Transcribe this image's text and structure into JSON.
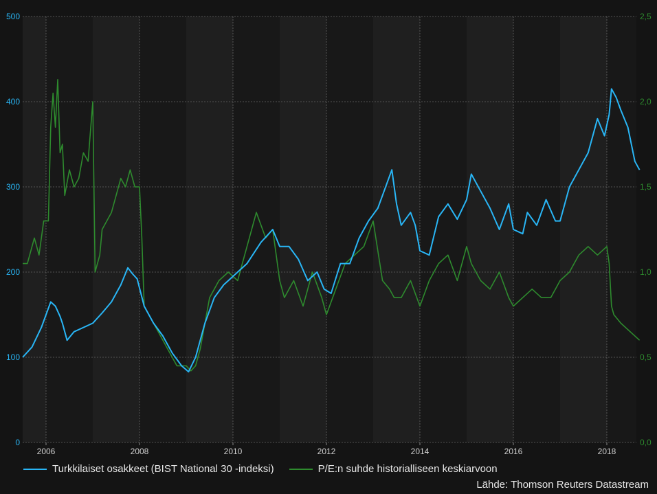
{
  "chart_data": {
    "type": "line",
    "x_ticks": [
      "2006",
      "2008",
      "2010",
      "2012",
      "2014",
      "2016",
      "2018"
    ],
    "y_left": {
      "ticks": [
        "0",
        "100",
        "200",
        "300",
        "400",
        "500"
      ],
      "range": [
        0,
        500
      ],
      "color": "#29b6f6"
    },
    "y_right": {
      "ticks": [
        "0,0",
        "0,5",
        "1,0",
        "1,5",
        "2,0",
        "2,5"
      ],
      "range": [
        0,
        2.5
      ],
      "color": "#2e8b2e"
    },
    "grid": true,
    "legend_position": "bottom-left",
    "series": [
      {
        "name": "Turkkilaiset osakkeet (BIST National 30 -indeksi)",
        "axis": "left",
        "color": "#29b6f6",
        "x": [
          2005.5,
          2005.7,
          2005.9,
          2006.1,
          2006.2,
          2006.3,
          2006.35,
          2006.45,
          2006.6,
          2006.8,
          2007.0,
          2007.2,
          2007.4,
          2007.6,
          2007.75,
          2007.85,
          2007.95,
          2008.1,
          2008.3,
          2008.5,
          2008.7,
          2008.9,
          2009.05,
          2009.2,
          2009.4,
          2009.6,
          2009.8,
          2010.0,
          2010.3,
          2010.6,
          2010.85,
          2011.0,
          2011.2,
          2011.4,
          2011.6,
          2011.8,
          2011.95,
          2012.1,
          2012.3,
          2012.5,
          2012.7,
          2012.9,
          2013.1,
          2013.3,
          2013.4,
          2013.5,
          2013.6,
          2013.8,
          2013.9,
          2014.0,
          2014.2,
          2014.4,
          2014.6,
          2014.8,
          2015.0,
          2015.1,
          2015.3,
          2015.5,
          2015.7,
          2015.9,
          2016.0,
          2016.2,
          2016.3,
          2016.5,
          2016.7,
          2016.9,
          2017.0,
          2017.2,
          2017.4,
          2017.6,
          2017.8,
          2017.95,
          2018.05,
          2018.1,
          2018.2,
          2018.3,
          2018.45,
          2018.6,
          2018.7
        ],
        "values": [
          100,
          112,
          135,
          165,
          160,
          148,
          140,
          120,
          130,
          135,
          140,
          152,
          165,
          185,
          205,
          198,
          192,
          160,
          140,
          125,
          105,
          90,
          83,
          100,
          140,
          170,
          185,
          195,
          210,
          235,
          250,
          230,
          230,
          215,
          190,
          200,
          180,
          175,
          210,
          210,
          240,
          260,
          275,
          305,
          320,
          280,
          255,
          270,
          255,
          225,
          220,
          265,
          280,
          262,
          285,
          315,
          295,
          275,
          250,
          280,
          250,
          245,
          270,
          255,
          285,
          260,
          260,
          300,
          320,
          340,
          380,
          360,
          385,
          415,
          405,
          390,
          370,
          330,
          320
        ]
      },
      {
        "name": "P/E:n suhde historialliseen keskiarvoon",
        "axis": "right",
        "color": "#2e8b2e",
        "x": [
          2005.5,
          2005.6,
          2005.75,
          2005.85,
          2005.95,
          2006.05,
          2006.1,
          2006.15,
          2006.2,
          2006.25,
          2006.3,
          2006.35,
          2006.4,
          2006.5,
          2006.6,
          2006.7,
          2006.8,
          2006.9,
          2007.0,
          2007.05,
          2007.1,
          2007.15,
          2007.2,
          2007.4,
          2007.5,
          2007.6,
          2007.7,
          2007.8,
          2007.9,
          2008.0,
          2008.05,
          2008.1,
          2008.2,
          2008.4,
          2008.6,
          2008.8,
          2009.0,
          2009.1,
          2009.2,
          2009.3,
          2009.5,
          2009.7,
          2009.9,
          2010.1,
          2010.3,
          2010.5,
          2010.7,
          2010.85,
          2011.0,
          2011.1,
          2011.2,
          2011.3,
          2011.5,
          2011.7,
          2011.9,
          2012.0,
          2012.2,
          2012.4,
          2012.6,
          2012.8,
          2013.0,
          2013.2,
          2013.35,
          2013.45,
          2013.6,
          2013.8,
          2014.0,
          2014.2,
          2014.4,
          2014.6,
          2014.8,
          2015.0,
          2015.1,
          2015.3,
          2015.5,
          2015.7,
          2015.9,
          2016.0,
          2016.2,
          2016.4,
          2016.6,
          2016.8,
          2017.0,
          2017.2,
          2017.4,
          2017.6,
          2017.8,
          2018.0,
          2018.05,
          2018.1,
          2018.15,
          2018.3,
          2018.5,
          2018.7
        ],
        "values": [
          1.05,
          1.05,
          1.2,
          1.1,
          1.3,
          1.3,
          1.85,
          2.05,
          1.85,
          2.13,
          1.7,
          1.75,
          1.45,
          1.6,
          1.5,
          1.55,
          1.7,
          1.65,
          2.0,
          1.0,
          1.05,
          1.1,
          1.25,
          1.35,
          1.45,
          1.55,
          1.5,
          1.6,
          1.5,
          1.5,
          1.2,
          0.8,
          0.75,
          0.65,
          0.55,
          0.45,
          0.45,
          0.42,
          0.45,
          0.55,
          0.85,
          0.95,
          1.0,
          0.95,
          1.15,
          1.35,
          1.2,
          1.25,
          0.95,
          0.85,
          0.9,
          0.95,
          0.8,
          1.0,
          0.85,
          0.75,
          0.9,
          1.05,
          1.1,
          1.15,
          1.3,
          0.95,
          0.9,
          0.85,
          0.85,
          0.95,
          0.8,
          0.95,
          1.05,
          1.1,
          0.95,
          1.15,
          1.05,
          0.95,
          0.9,
          1.0,
          0.85,
          0.8,
          0.85,
          0.9,
          0.85,
          0.85,
          0.95,
          1.0,
          1.1,
          1.15,
          1.1,
          1.15,
          1.05,
          0.8,
          0.75,
          0.7,
          0.65,
          0.6
        ]
      }
    ],
    "source": "Lähde: Thomson Reuters Datastream"
  }
}
